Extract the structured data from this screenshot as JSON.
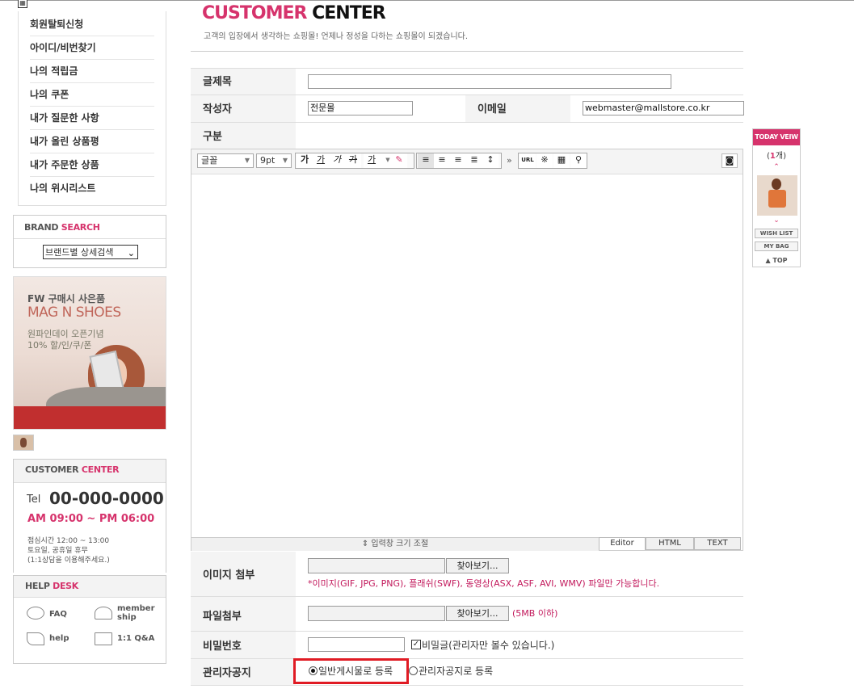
{
  "left_menu": {
    "items": [
      {
        "label": "회원탈퇴신청"
      },
      {
        "label": "아이디/비번찾기"
      },
      {
        "label": "나의 적립금"
      },
      {
        "label": "나의 쿠폰"
      },
      {
        "label": "내가 질문한 사항"
      },
      {
        "label": "내가 올린 상품평"
      },
      {
        "label": "내가 주문한 상품"
      },
      {
        "label": "나의 위시리스트"
      }
    ]
  },
  "brand_search": {
    "title_a": "BRAND",
    "title_b": "SEARCH",
    "select_value": "브랜드별 상세검색"
  },
  "banner": {
    "line1": "FW 구매시 사은품",
    "line2": "MAG N SHOES",
    "line3": "원파인데이 오픈기념",
    "line4": "10% 할/인/쿠/폰"
  },
  "customer_center": {
    "title_a": "CUSTOMER",
    "title_b": "CENTER",
    "tel_label": "Tel",
    "tel": "00-000-0000",
    "hours": "AM 09:00 ~ PM 06:00",
    "notes": [
      "점심시간 12:00 ~ 13:00",
      "토요일, 공휴일 휴무",
      "(1:1상담을 이용해주세요.)"
    ]
  },
  "help_desk": {
    "title_a": "HELP",
    "title_b": "DESK",
    "faq": "FAQ",
    "membership_1": "member",
    "membership_2": "ship",
    "help": "help",
    "qna": "1:1 Q&A"
  },
  "header": {
    "title_a": "CUSTOMER",
    "title_b": "CENTER",
    "subtitle": "고객의 입장에서 생각하는 쇼핑몰! 언제나 정성을 다하는 쇼핑몰이 되겠습니다."
  },
  "form": {
    "subject_label": "글제목",
    "subject_value": "",
    "author_label": "작성자",
    "author_value": "전문몰",
    "email_label": "이메일",
    "email_value": "webmaster@mallstore.co.kr",
    "category_label": "구분",
    "image_label": "이미지 첨부",
    "browse": "찾아보기...",
    "image_note": "*이미지(GIF, JPG, PNG), 플래쉬(SWF), 동영상(ASX, ASF, AVI, WMV) 파일만 가능합니다.",
    "file_label": "파일첨부",
    "file_note": "(5MB 이하)",
    "password_label": "비밀번호",
    "secret_label": "비밀글(관리자만 볼수 있습니다.)",
    "notice_label": "관리자공지",
    "radio_normal": "일반게시물로 등록",
    "radio_notice": "관리자공지로 등록"
  },
  "editor": {
    "font": "글꼴",
    "size": "9pt",
    "bold": "가",
    "underline": "가",
    "italic": "가",
    "strike": "가",
    "color": "가",
    "url": "URL",
    "more": "»",
    "resize": "입력창 크기 조절",
    "tab_editor": "Editor",
    "tab_html": "HTML",
    "tab_text": "TEXT"
  },
  "today_view": {
    "title": "TODAY VEIW",
    "count_prefix": "(",
    "count": "1",
    "count_suffix": "개)",
    "wish": "WISH LIST",
    "bag": "MY BAG",
    "top": "▲ TOP"
  },
  "colors": {
    "accent": "#d6336c",
    "highlight": "#e01b24"
  }
}
